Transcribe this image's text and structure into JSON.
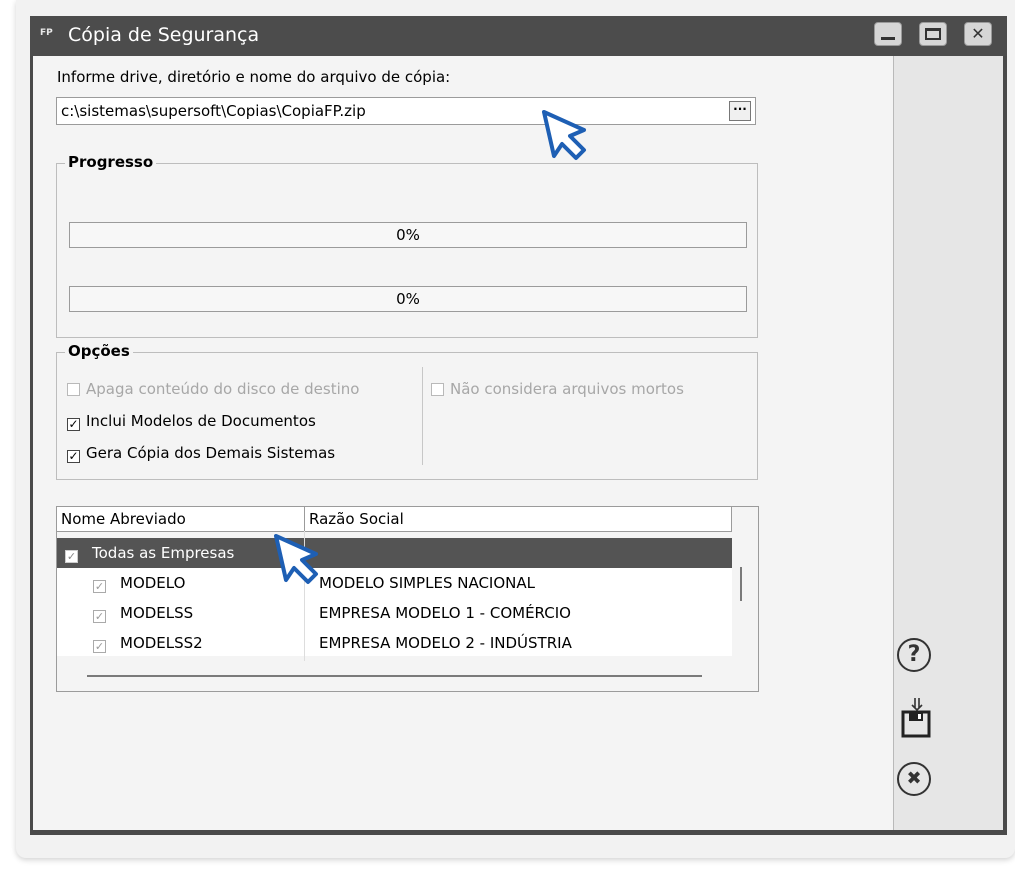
{
  "window": {
    "app_icon": "FP",
    "title": "Cópia de Segurança",
    "close_glyph": "✕"
  },
  "file": {
    "label": "Informe drive, diretório e nome do arquivo de cópia:",
    "value": "c:\\sistemas\\supersoft\\Copias\\CopiaFP.zip",
    "browse_label": "···"
  },
  "progress": {
    "title": "Progresso",
    "bar1": {
      "text": "0%",
      "value": 0
    },
    "bar2": {
      "text": "0%",
      "value": 0
    }
  },
  "options": {
    "title": "Opções",
    "items": [
      {
        "label": "Apaga conteúdo do disco de destino",
        "checked": false,
        "enabled": false
      },
      {
        "label": "Inclui Modelos de Documentos",
        "checked": true,
        "enabled": true
      },
      {
        "label": "Gera Cópia dos Demais Sistemas",
        "checked": true,
        "enabled": true
      },
      {
        "label": "Não considera arquivos mortos",
        "checked": false,
        "enabled": false
      }
    ],
    "check_glyph": "✓"
  },
  "grid": {
    "columns": [
      "Nome Abreviado",
      "Razão Social"
    ],
    "all_row": {
      "label": "Todas as Empresas",
      "checked": true
    },
    "rows": [
      {
        "code": "MODELO",
        "name": "MODELO SIMPLES NACIONAL",
        "checked": true
      },
      {
        "code": "MODELSS",
        "name": "EMPRESA MODELO 1 - COMÉRCIO",
        "checked": true
      },
      {
        "code": "MODELSS2",
        "name": "EMPRESA MODELO 2 - INDÚSTRIA",
        "checked": true
      }
    ]
  },
  "actions": {
    "help_glyph": "?",
    "cancel_glyph": "✖"
  },
  "colors": {
    "titlebar": "#4c4c4c",
    "selected_row": "#545454",
    "cursor_fill": "#ffffff",
    "cursor_stroke": "#1e5fb4"
  },
  "icons": [
    "help-icon",
    "save-icon",
    "cancel-icon",
    "mouse-pointer-icon"
  ]
}
